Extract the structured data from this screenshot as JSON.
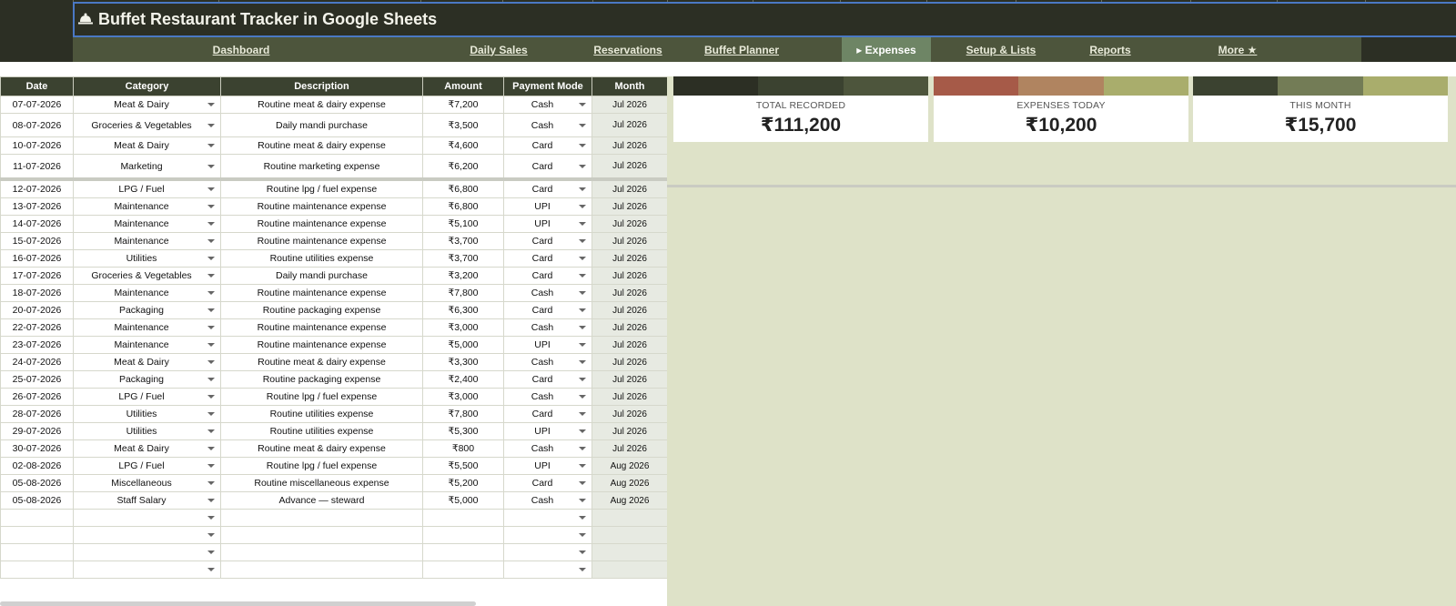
{
  "app": {
    "title": "Buffet Restaurant Tracker in Google Sheets",
    "logo_icon": "cloche-icon"
  },
  "nav": {
    "items": [
      {
        "label": "Dashboard",
        "active": false
      },
      {
        "label": "Daily Sales",
        "active": false
      },
      {
        "label": "Reservations",
        "active": false
      },
      {
        "label": "Buffet Planner",
        "active": false
      },
      {
        "label": "▸ Expenses",
        "active": true
      },
      {
        "label": "Setup & Lists",
        "active": false
      },
      {
        "label": "Reports",
        "active": false
      },
      {
        "label": "More ★",
        "active": false
      }
    ]
  },
  "table": {
    "headers": [
      "Date",
      "Category",
      "Description",
      "Amount",
      "Payment Mode",
      "Month"
    ],
    "rows": [
      [
        "07-07-2026",
        "Meat & Dairy",
        "Routine meat & dairy expense",
        "₹7,200",
        "Cash",
        "Jul 2026"
      ],
      [
        "08-07-2026",
        "Groceries & Vegetables",
        "Daily mandi purchase",
        "₹3,500",
        "Cash",
        "Jul 2026"
      ],
      [
        "10-07-2026",
        "Meat & Dairy",
        "Routine meat & dairy expense",
        "₹4,600",
        "Card",
        "Jul 2026"
      ],
      [
        "11-07-2026",
        "Marketing",
        "Routine marketing expense",
        "₹6,200",
        "Card",
        "Jul 2026"
      ],
      [
        "12-07-2026",
        "LPG / Fuel",
        "Routine lpg / fuel expense",
        "₹6,800",
        "Card",
        "Jul 2026"
      ],
      [
        "13-07-2026",
        "Maintenance",
        "Routine maintenance expense",
        "₹6,800",
        "UPI",
        "Jul 2026"
      ],
      [
        "14-07-2026",
        "Maintenance",
        "Routine maintenance expense",
        "₹5,100",
        "UPI",
        "Jul 2026"
      ],
      [
        "15-07-2026",
        "Maintenance",
        "Routine maintenance expense",
        "₹3,700",
        "Card",
        "Jul 2026"
      ],
      [
        "16-07-2026",
        "Utilities",
        "Routine utilities expense",
        "₹3,700",
        "Card",
        "Jul 2026"
      ],
      [
        "17-07-2026",
        "Groceries & Vegetables",
        "Daily mandi purchase",
        "₹3,200",
        "Card",
        "Jul 2026"
      ],
      [
        "18-07-2026",
        "Maintenance",
        "Routine maintenance expense",
        "₹7,800",
        "Cash",
        "Jul 2026"
      ],
      [
        "20-07-2026",
        "Packaging",
        "Routine packaging expense",
        "₹6,300",
        "Card",
        "Jul 2026"
      ],
      [
        "22-07-2026",
        "Maintenance",
        "Routine maintenance expense",
        "₹3,000",
        "Cash",
        "Jul 2026"
      ],
      [
        "23-07-2026",
        "Maintenance",
        "Routine maintenance expense",
        "₹5,000",
        "UPI",
        "Jul 2026"
      ],
      [
        "24-07-2026",
        "Meat & Dairy",
        "Routine meat & dairy expense",
        "₹3,300",
        "Cash",
        "Jul 2026"
      ],
      [
        "25-07-2026",
        "Packaging",
        "Routine packaging expense",
        "₹2,400",
        "Card",
        "Jul 2026"
      ],
      [
        "26-07-2026",
        "LPG / Fuel",
        "Routine lpg / fuel expense",
        "₹3,000",
        "Cash",
        "Jul 2026"
      ],
      [
        "28-07-2026",
        "Utilities",
        "Routine utilities expense",
        "₹7,800",
        "Card",
        "Jul 2026"
      ],
      [
        "29-07-2026",
        "Utilities",
        "Routine utilities expense",
        "₹5,300",
        "UPI",
        "Jul 2026"
      ],
      [
        "30-07-2026",
        "Meat & Dairy",
        "Routine meat & dairy expense",
        "₹800",
        "Cash",
        "Jul 2026"
      ],
      [
        "02-08-2026",
        "LPG / Fuel",
        "Routine lpg / fuel expense",
        "₹5,500",
        "UPI",
        "Aug 2026"
      ],
      [
        "05-08-2026",
        "Miscellaneous",
        "Routine miscellaneous expense",
        "₹5,200",
        "Card",
        "Aug 2026"
      ],
      [
        "05-08-2026",
        "Staff Salary",
        "Advance — steward",
        "₹5,000",
        "Cash",
        "Aug 2026"
      ],
      [
        "",
        "",
        "",
        "",
        "",
        ""
      ],
      [
        "",
        "",
        "",
        "",
        "",
        ""
      ],
      [
        "",
        "",
        "",
        "",
        "",
        ""
      ],
      [
        "",
        "",
        "",
        "",
        "",
        ""
      ]
    ]
  },
  "cards": [
    {
      "label": "TOTAL RECORDED",
      "value": "₹111,200",
      "colors": [
        "#2c2f24",
        "#3b4230",
        "#4d553c"
      ]
    },
    {
      "label": "EXPENSES TODAY",
      "value": "₹10,200",
      "colors": [
        "#a65a48",
        "#b08460",
        "#a9ad6c"
      ]
    },
    {
      "label": "THIS MONTH",
      "value": "₹15,700",
      "colors": [
        "#3b4230",
        "#737c56",
        "#a9ad6c"
      ]
    }
  ],
  "colors": {
    "title_band": "#2c2f24",
    "nav_band": "#4d553c",
    "nav_active": "#6e8565",
    "header_row": "#3b4230",
    "panel_bg": "#dee2c8",
    "selection_border": "#4a78c4"
  }
}
